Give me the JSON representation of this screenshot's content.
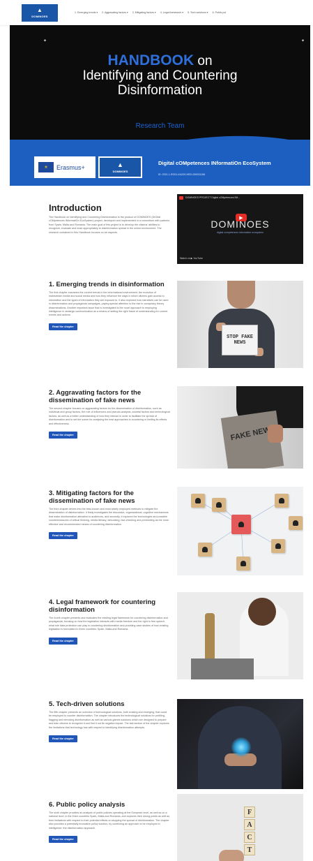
{
  "nav": {
    "logo_text": "DOMINOES",
    "items": [
      "1. Emerging trends ▾",
      "2. Aggravating factors ▾",
      "3. Mitigating factors ▾",
      "4. Legal framework ▾",
      "5. Tech solutions ▾",
      "6. Public pol"
    ]
  },
  "hero": {
    "title_highlight": "HANDBOOK",
    "title_rest_1": "on",
    "title_line2": "Identifying and Countering",
    "title_line3": "Disinformation",
    "subtitle": "Research Team"
  },
  "band": {
    "erasmus_text": "Erasmus+",
    "logo_text": "DOMINOES",
    "title": "Digital cOMpetences INformatiOn EcoSystem",
    "subtitle": "ID: 2021-1-RO01-KA220-HED-000031158"
  },
  "video": {
    "bar_title": "DOMINOES PROJECT Digital cOMpetences INf...",
    "logo": "DOMINOES",
    "tagline": "digital competences information ecosystem",
    "watch": "Watch on ▶ YouTube"
  },
  "sections": [
    {
      "title": "Introduction",
      "text": "The Handbook on Identifying and Countering Disinformation is the product of DOMINOES (DIGItal cOMpetences INformatiOn EcoSystem) project, developed and implemented in a consortium with partners from Spain, Malta and Romania. The main goal of this project is to develop the citizens' abilities to recognize, evaluate and react appropriately to disinformation spread in the online environment. The research contained in this Handbook focuses on six aspects.",
      "button": ""
    },
    {
      "title": "1. Emerging trends in disinformation",
      "text": "The first chapter examines the current trends in the informational environment, the evolution of mainstream media and social media and how they influence the ways in which citizens gain access to information and the types of information they are exposed to. It also explored how narratives can be used in disinformation and propaganda campaigns, paying special attention to the rise in conspiracy theory disseminations. Another important issue that is investigated is the novel approach to employing intelligence in strategic communication as a means of setting the right frame of understanding for current events and actions.",
      "button": "Read the chapter"
    },
    {
      "title": "2. Aggravating factors for the dissemination of fake news",
      "text": "The second chapter focuses on aggravating factors for the dissemination of disinformation, such as individual and group factors, the role of influencers and pseudo-analysts, societal factors and technological factors, as well as a better understanding of how they interact in order to facilitate the spread of disinformation and to set the scene for analysing the best approaches to countering or limiting its effects and effectiveness.",
      "button": "Read the chapter"
    },
    {
      "title": "3. Mitigating factors for the dissemination of fake news",
      "text": "The third chapter delves into the best-known and most widely employed methods to mitigate the dissemination of disinformation. It firstly investigates the discursive, organizational, cognitive mechanisms that make disinformation attractive to audiences, and secondly, it explores the technologies and possible countermeasures of critical thinking, media literacy, debunking, fact-checking and prebunking as the most effective and recommended means of countering disinformation.",
      "button": "Read the chapter"
    },
    {
      "title": "4. Legal framework for countering disinformation",
      "text": "The fourth chapter presents and evaluates the existing legal framework for countering disinformation and propaganda, focusing on how the legislation interacts with media freedom and the right to free speech, what role data protection can play in countering disinformation and providing case studies of how existing legislation is formulated in three countries: Spain, Malta and Romania.",
      "button": "Read the chapter"
    },
    {
      "title": "5. Tech-driven solutions",
      "text": "The fifth chapter presents an overview of technological solutions, both existing and emerging, that could be employed to counter disinformation. The chapter introduces the technological solutions for profiling, flagging and removing disinformation as well as various games solutions which are designed to prepare and train citizens to recognize it and find it out its negative impact. The last section of the chapter explores the limitations that technology has with respect to identifying disinformation attempts.",
      "button": "Read the chapter"
    },
    {
      "title": "6. Public policy analysis",
      "text": "The sixth chapter provides an analysis of public policies operating at the European level, as well as on a national level, in the three countries Spain, Malta and Romania, and explores their strong points as well as their limitations with respect to their potential effects on stopping the spread of disinformation. The chapter also provides a potentially innovative policy solution, by combining an approach to be employed in intelligence: the disinformation approach.",
      "button": "Read the chapter"
    }
  ],
  "images": {
    "stop_sign": "STOP FAKE NEWS",
    "news_paper": "FAKE NEWS",
    "fact_letters": [
      "F",
      "A",
      "C",
      "T"
    ]
  },
  "colors": {
    "brand_blue": "#1d5fc0",
    "hero_bg": "#0c0c0c",
    "highlight": "#2f6fdc",
    "button": "#2056b8"
  }
}
